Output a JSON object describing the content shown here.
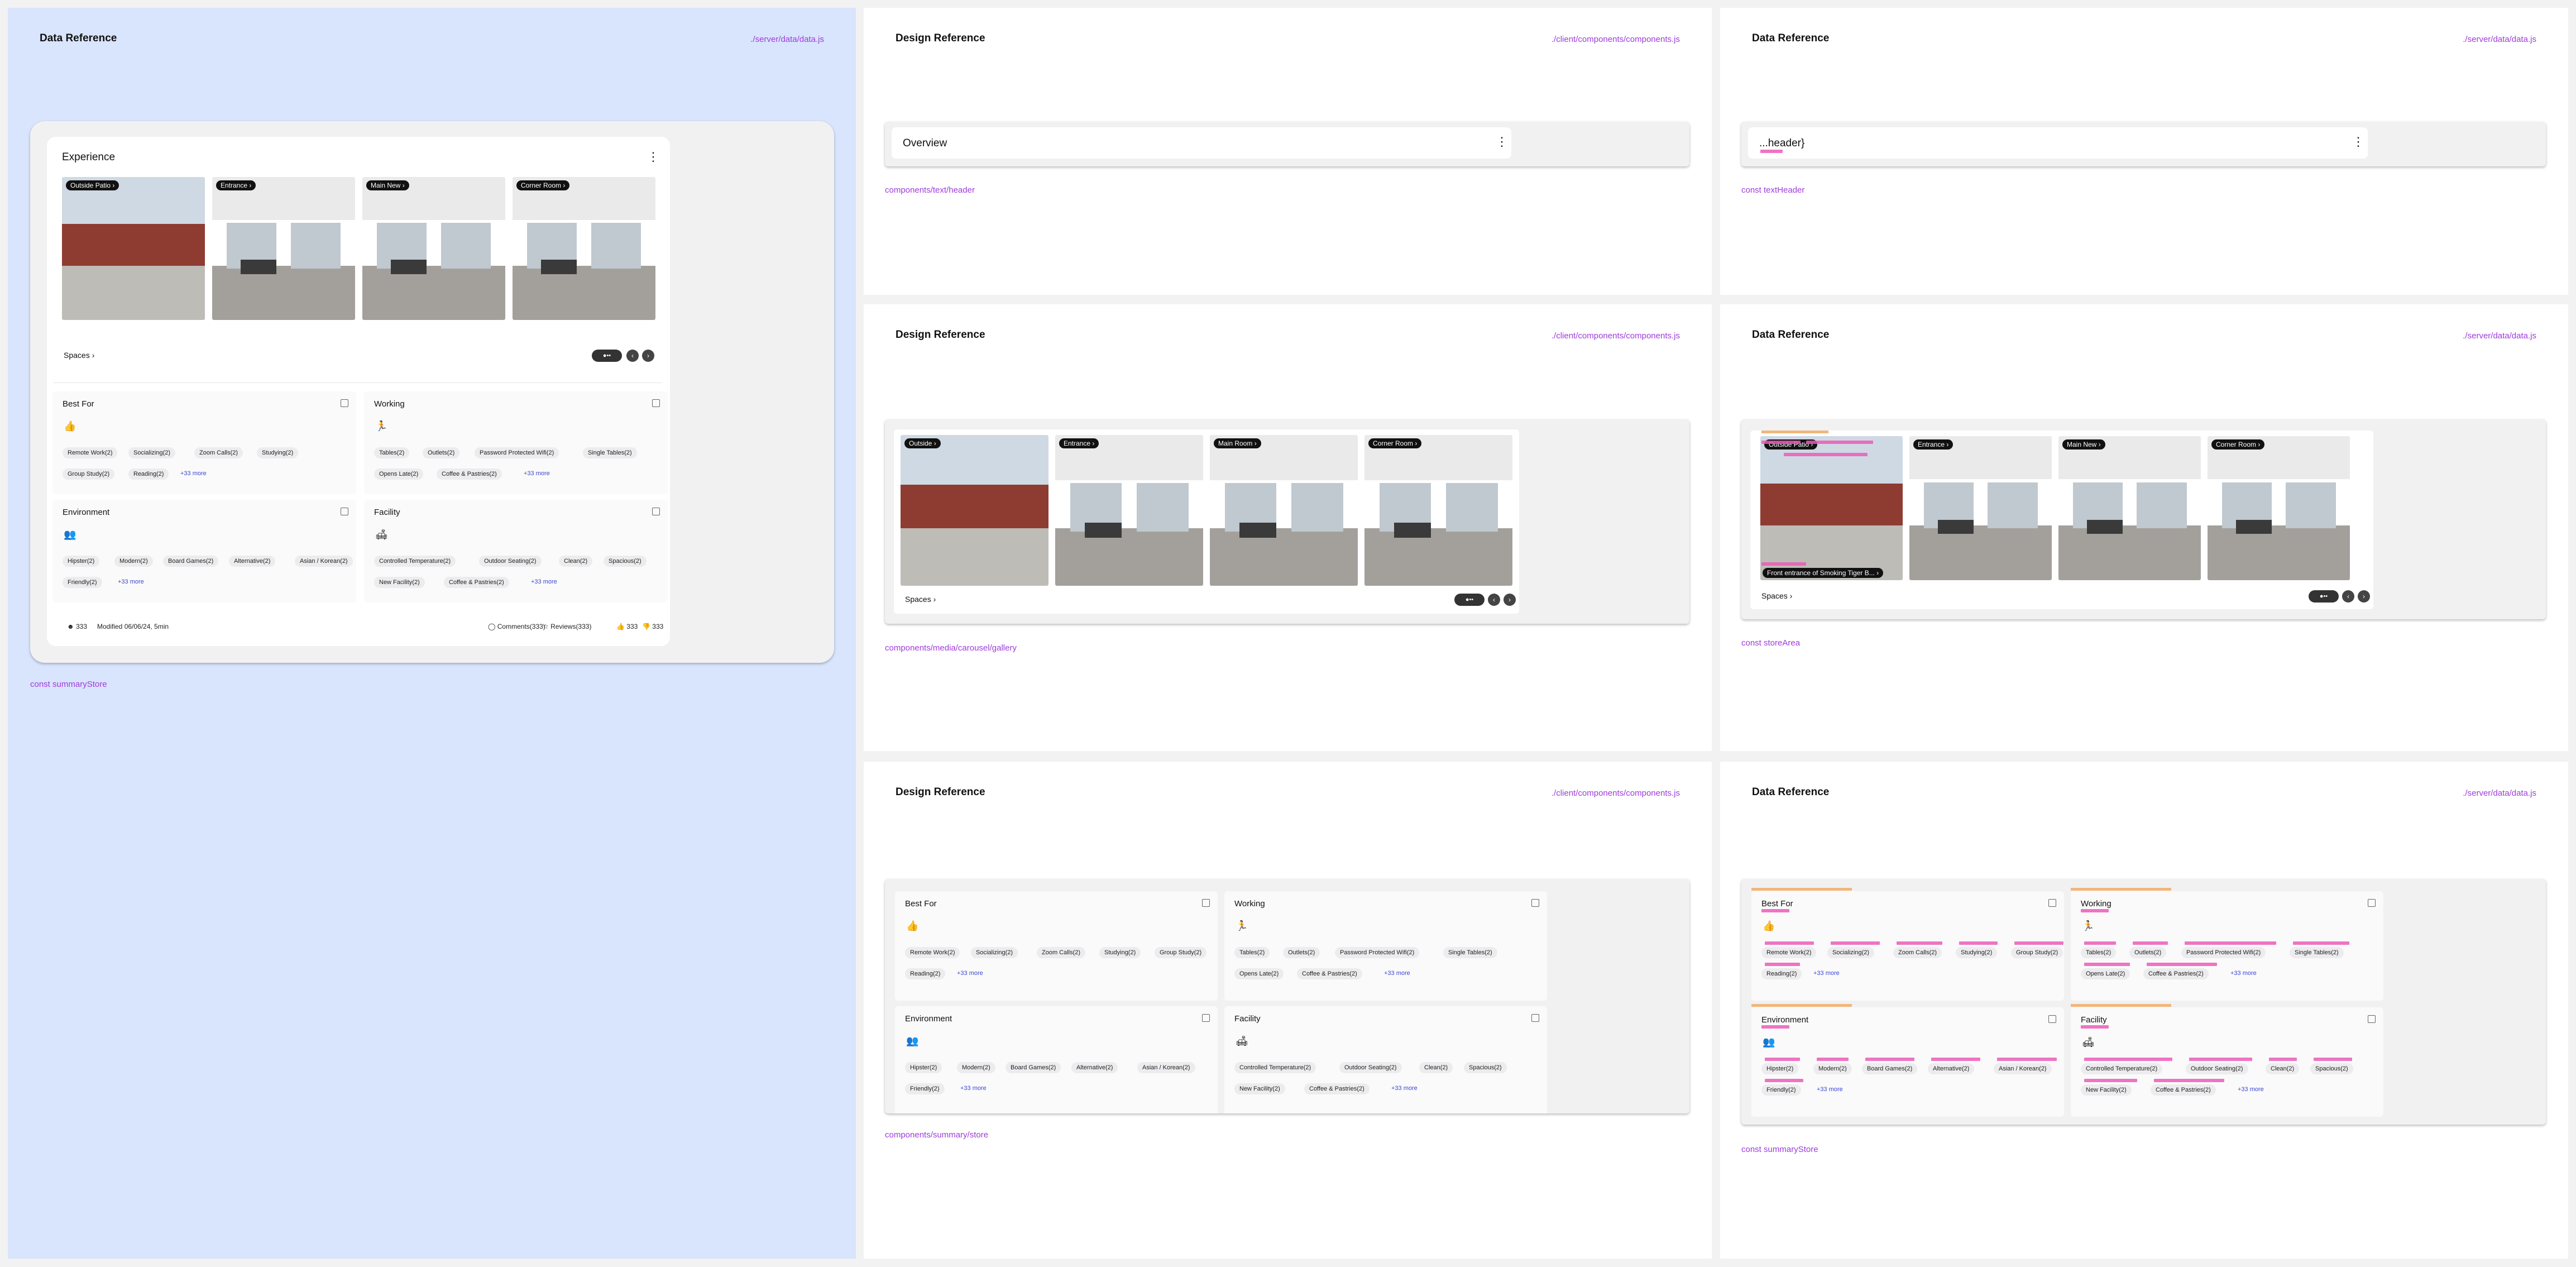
{
  "panels": {
    "main": {
      "title": "Data Reference",
      "path": "./server/data/data.js",
      "link": "const summaryStore"
    },
    "header_design": {
      "title": "Design Reference",
      "path": "./client/components/components.js",
      "link": "components/text/header",
      "header_title": "Overview"
    },
    "header_data": {
      "title": "Data Reference",
      "path": "./server/data/data.js",
      "link": "const textHeader",
      "header_title": "...header}"
    },
    "gallery_design": {
      "title": "Design Reference",
      "path": "./client/components/components.js",
      "link": "components/media/carousel/gallery"
    },
    "gallery_data": {
      "title": "Data Reference",
      "path": "./server/data/data.js",
      "link": "const storeArea",
      "first_caption": "Front entrance of Smoking Tiger B..."
    },
    "summary_design": {
      "title": "Design Reference",
      "path": "./client/components/components.js",
      "link": "components/summary/store"
    },
    "summary_data": {
      "title": "Data Reference",
      "path": "./server/data/data.js",
      "link": "const summaryStore"
    }
  },
  "experience": {
    "title": "Experience",
    "spaces_label": "Spaces",
    "photos": [
      "Outside Patio",
      "Entrance",
      "Main New",
      "Corner Room"
    ],
    "footer": {
      "people": "333",
      "modified": "Modified 06/06/24, 5min",
      "comments": "Comments(333)",
      "reviews": "Reviews(333)",
      "likes": "333",
      "dislikes": "333"
    }
  },
  "gallery_design_photos": [
    "Outside",
    "Entrance",
    "Main Room",
    "Corner Room"
  ],
  "gallery_data_photos": [
    "Outside Patio",
    "Entrance",
    "Main New",
    "Corner Room"
  ],
  "summary": {
    "best_for": {
      "title": "Best For",
      "row1": [
        "Remote Work(2)",
        "Socializing(2)",
        "Zoom Calls(2)",
        "Studying(2)"
      ],
      "row2": [
        "Group Study(2)",
        "Reading(2)"
      ],
      "more": "+33 more"
    },
    "working": {
      "title": "Working",
      "row1": [
        "Tables(2)",
        "Outlets(2)",
        "Password Protected Wifi(2)",
        "Single Tables(2)"
      ],
      "row2": [
        "Opens Late(2)",
        "Coffee & Pastries(2)"
      ],
      "more": "+33 more"
    },
    "environment": {
      "title": "Environment",
      "row1": [
        "Hipster(2)",
        "Modern(2)",
        "Board Games(2)",
        "Alternative(2)",
        "Asian / Korean(2)"
      ],
      "row2": [
        "Friendly(2)"
      ],
      "more": "+33 more"
    },
    "facility": {
      "title": "Facility",
      "row1": [
        "Controlled Temperature(2)",
        "Outdoor Seating(2)",
        "Clean(2)",
        "Spacious(2)"
      ],
      "row2": [
        "New Facility(2)",
        "Coffee & Pastries(2)"
      ],
      "more": "+33 more"
    }
  },
  "summary_design": {
    "best_for": {
      "title": "Best For",
      "row1": [
        "Remote Work(2)",
        "Socializing(2)",
        "Zoom Calls(2)",
        "Studying(2)",
        "Group Study(2)"
      ],
      "row2": [
        "Reading(2)"
      ],
      "more": "+33 more"
    },
    "working": {
      "title": "Working",
      "row1": [
        "Tables(2)",
        "Outlets(2)",
        "Password Protected Wifi(2)",
        "Single Tables(2)"
      ],
      "row2": [
        "Opens Late(2)",
        "Coffee & Pastries(2)"
      ],
      "more": "+33 more"
    },
    "environment": {
      "title": "Environment",
      "row1": [
        "Hipster(2)",
        "Modern(2)",
        "Board Games(2)",
        "Alternative(2)",
        "Asian / Korean(2)"
      ],
      "row2": [
        "Friendly(2)"
      ],
      "more": "+33 more"
    },
    "facility": {
      "title": "Facility",
      "row1": [
        "Controlled Temperature(2)",
        "Outdoor Seating(2)",
        "Clean(2)",
        "Spacious(2)"
      ],
      "row2": [
        "New Facility(2)",
        "Coffee & Pastries(2)"
      ],
      "more": "+33 more"
    }
  },
  "summary_data_cards": {
    "best_for": {
      "title": "Best For",
      "row1": [
        "Remote Work(2)",
        "Socializing(2)",
        "Zoom Calls(2)",
        "Studying(2)",
        "Group Study(2)"
      ],
      "row2": [
        "Reading(2)"
      ],
      "more": "+33 more"
    },
    "working": {
      "title": "Working",
      "row1": [
        "Tables(2)",
        "Outlets(2)",
        "Password Protected Wifi(2)",
        "Single Tables(2)"
      ],
      "row2": [
        "Opens Late(2)",
        "Coffee & Pastries(2)"
      ],
      "more": "+33 more"
    },
    "environment": {
      "title": "Environment",
      "row1": [
        "Hipster(2)",
        "Modern(2)",
        "Board Games(2)",
        "Alternative(2)",
        "Asian / Korean(2)"
      ],
      "row2": [
        "Friendly(2)"
      ],
      "more": "+33 more"
    },
    "facility": {
      "title": "Facility",
      "row1": [
        "Controlled Temperature(2)",
        "Outdoor Seating(2)",
        "Clean(2)",
        "Spacious(2)"
      ],
      "row2": [
        "New Facility(2)",
        "Coffee & Pastries(2)"
      ],
      "more": "+33 more"
    }
  }
}
